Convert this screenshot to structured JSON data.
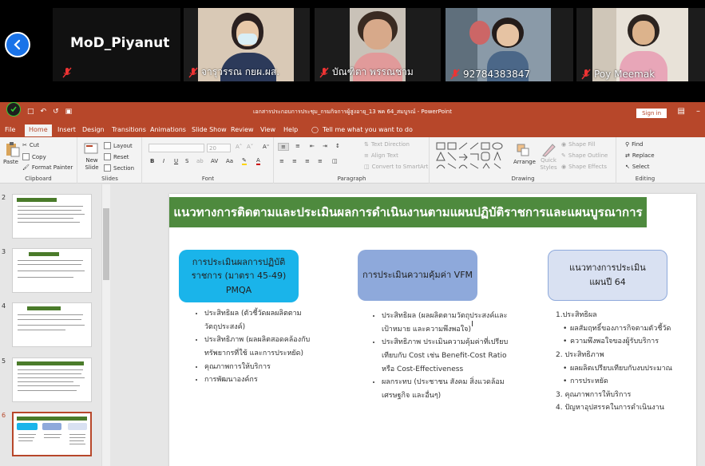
{
  "meeting": {
    "host_name": "MoD_Piyanut",
    "participants": [
      {
        "name": "จารุวรรณ กยผ.ผส."
      },
      {
        "name": "บัณฑิตา พรรณชาม"
      },
      {
        "name": "92784383847"
      },
      {
        "name": "Poy Meemak"
      }
    ]
  },
  "powerpoint": {
    "doc_title": "เอกสารประกอบการประชุม_กรมกิจการผู้สูงอายุ_13 พค 64_สมบูรณ์ - PowerPoint",
    "sign_in": "Sign in",
    "tabs": [
      "File",
      "Home",
      "Insert",
      "Design",
      "Transitions",
      "Animations",
      "Slide Show",
      "Review",
      "View",
      "Help",
      "Tell me what you want to do"
    ],
    "ribbon": {
      "clipboard": {
        "paste": "Paste",
        "cut": "Cut",
        "copy": "Copy",
        "format_painter": "Format Painter",
        "label": "Clipboard"
      },
      "slides": {
        "new_slide": "New Slide",
        "layout": "Layout",
        "reset": "Reset",
        "section": "Section",
        "label": "Slides"
      },
      "font": {
        "size": "20",
        "label": "Font"
      },
      "paragraph": {
        "text_direction": "Text Direction",
        "align_text": "Align Text",
        "convert_smartart": "Convert to SmartArt",
        "label": "Paragraph"
      },
      "drawing": {
        "arrange": "Arrange",
        "quick_styles": "Quick Styles",
        "shape_fill": "Shape Fill",
        "shape_outline": "Shape Outline",
        "shape_effects": "Shape Effects",
        "label": "Drawing"
      },
      "editing": {
        "find": "Find",
        "replace": "Replace",
        "select": "Select",
        "label": "Editing"
      }
    },
    "thumbnails": [
      "2",
      "3",
      "4",
      "5",
      "6"
    ],
    "slide": {
      "title": "แนวทางการติดตามและประเมินผลการดำเนินงานตามแผนปฏิบัติราชการและแผนบูรณาการ",
      "box1": {
        "line1": "การประเมินผลการปฏิบัติ",
        "line2": "ราชการ (มาตรา 45-49)",
        "line3": "PMQA",
        "color": "#1ab4ea"
      },
      "box2": {
        "text": "การประเมินความคุ้มค่า VFM",
        "color": "#8ea9db"
      },
      "box3": {
        "line1": "แนวทางการประเมิน",
        "line2": "แผนปี 64",
        "color": "#d9e1f2"
      },
      "col1": [
        "ประสิทธิผล (ตัวชี้วัดผลผลิตตามวัตถุประสงค์)",
        "ประสิทธิภาพ (ผลผลิตสอดคล้องกับทรัพยากรที่ใช้ และการประหยัด)",
        "คุณภาพการให้บริการ",
        "การพัฒนาองค์กร"
      ],
      "col2": [
        "ประสิทธิผล (ผลผลิตตามวัตถุประสงค์และเป้าหมาย และความพึงพอใจ)",
        "ประสิทธิภาพ ประเมินความคุ้มค่าที่เปรียบเทียบกับ Cost เช่น Benefit-Cost Ratio หรือ Cost-Effectiveness",
        "ผลกระทบ (ประชาชน สังคม สิ่งแวดล้อม เศรษฐกิจ และอื่นๆ)"
      ],
      "col3": [
        {
          "text": "1.ประสิทธิผล",
          "sub": false
        },
        {
          "text": "ผลสัมฤทธิ์ของภารกิจตามตัวชี้วัด",
          "sub": true
        },
        {
          "text": "ความพึงพอใจของผู้รับบริการ",
          "sub": true
        },
        {
          "text": "2. ประสิทธิภาพ",
          "sub": false
        },
        {
          "text": "ผลผลิตเปรียบเทียบกับงบประมาณ",
          "sub": true
        },
        {
          "text": "การประหยัด",
          "sub": true
        },
        {
          "text": "3. คุณภาพการให้บริการ",
          "sub": false
        },
        {
          "text": "4. ปัญหาอุปสรรคในการดำเนินงาน",
          "sub": false
        }
      ]
    }
  }
}
